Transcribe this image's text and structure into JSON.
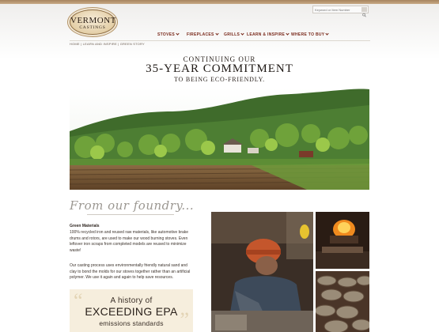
{
  "header": {
    "logo": {
      "top": "VERMONT",
      "bottom": "CASTINGS"
    },
    "search": {
      "placeholder": "Keyword or Item Number"
    },
    "nav": [
      {
        "label": "STOVES"
      },
      {
        "label": "FIREPLACES"
      },
      {
        "label": "GRILLS"
      },
      {
        "label": "LEARN & INSPIRE"
      },
      {
        "label": "WHERE TO BUY"
      }
    ]
  },
  "breadcrumb": "HOME  |  LEARN AND INSPIRE  |  GREEN STORY",
  "intro": {
    "line1": "CONTINUING OUR",
    "line2": "35-YEAR COMMITMENT",
    "line3": "TO BEING ECO-FRIENDLY."
  },
  "section": {
    "heading": "From our foundry...",
    "materials_title": "Green Materials",
    "paragraph1": "100% recycled iron and reused raw materials, like automotive brake drums and rotors, are used to make our wood burning stoves. Even leftover iron scraps from completed models are reused to minimize waste!",
    "paragraph2": "Our casting process uses environmentally friendly natural sand and clay to bond the molds for our stoves together rather than an artificial polymer. We use it again and again to help save resources."
  },
  "epa": {
    "line1": "A history of",
    "line2": "EXCEEDING EPA",
    "line3": "emissions standards"
  },
  "icons": {
    "search": "search-icon",
    "chevron": "chevron-down-icon"
  },
  "colors": {
    "nav": "#7a2a1c",
    "accent_band": "#b8966d",
    "epa_bg": "#f6eedd"
  }
}
